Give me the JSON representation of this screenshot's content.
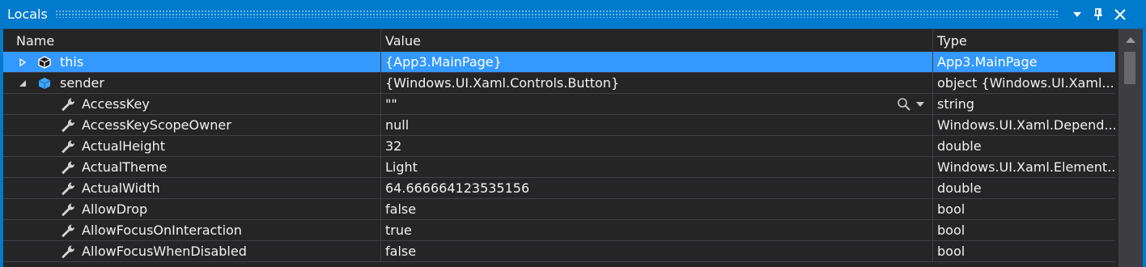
{
  "window": {
    "title": "Locals"
  },
  "columns": {
    "name": "Name",
    "value": "Value",
    "type": "Type"
  },
  "rows": [
    {
      "name": "this",
      "value": "{App3.MainPage}",
      "type": "App3.MainPage",
      "icon": "object-icon",
      "expander": "collapsed",
      "selected": true,
      "indent": 0
    },
    {
      "name": "sender",
      "value": "{Windows.UI.Xaml.Controls.Button}",
      "type": "object {Windows.UI.Xaml...",
      "icon": "object-icon",
      "expander": "expanded",
      "indent": 0
    },
    {
      "name": "AccessKey",
      "value": "\"\"",
      "type": "string",
      "icon": "wrench-icon",
      "indent": 1,
      "has_visualizer": true
    },
    {
      "name": "AccessKeyScopeOwner",
      "value": "null",
      "type": "Windows.UI.Xaml.Depend...",
      "icon": "wrench-icon",
      "indent": 1
    },
    {
      "name": "ActualHeight",
      "value": "32",
      "type": "double",
      "icon": "wrench-icon",
      "indent": 1
    },
    {
      "name": "ActualTheme",
      "value": "Light",
      "type": "Windows.UI.Xaml.Element...",
      "icon": "wrench-icon",
      "indent": 1
    },
    {
      "name": "ActualWidth",
      "value": "64.666664123535156",
      "type": "double",
      "icon": "wrench-icon",
      "indent": 1
    },
    {
      "name": "AllowDrop",
      "value": "false",
      "type": "bool",
      "icon": "wrench-icon",
      "indent": 1
    },
    {
      "name": "AllowFocusOnInteraction",
      "value": "true",
      "type": "bool",
      "icon": "wrench-icon",
      "indent": 1
    },
    {
      "name": "AllowFocusWhenDisabled",
      "value": "false",
      "type": "bool",
      "icon": "wrench-icon",
      "indent": 1
    }
  ],
  "colors": {
    "accent": "#007acc",
    "selection": "#3399ff",
    "background": "#252526"
  }
}
